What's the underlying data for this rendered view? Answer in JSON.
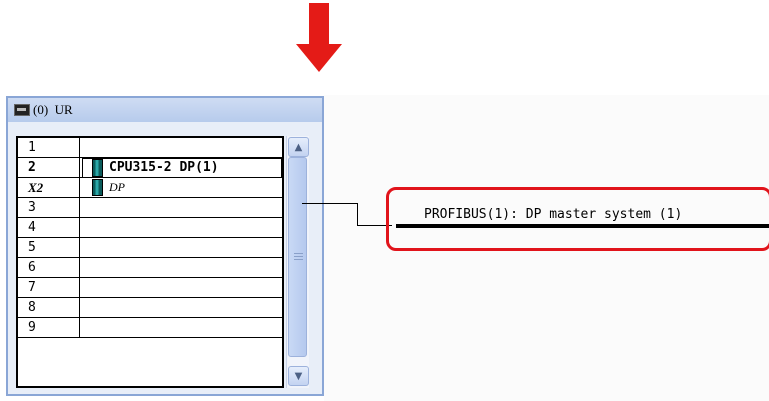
{
  "colors": {
    "arrow": "#e41b17",
    "highlight_box": "#e1141b",
    "titlebar": "#c4d4ef",
    "bus": "#000000",
    "module_icon": "#1a7a7a"
  },
  "rack": {
    "title": "(0)  UR",
    "icon": "rack-icon",
    "slots": [
      {
        "num": "1",
        "module": ""
      },
      {
        "num": "2",
        "module": "CPU315-2 DP(1)"
      },
      {
        "num": "X2",
        "module": "DP"
      },
      {
        "num": "3",
        "module": ""
      },
      {
        "num": "4",
        "module": ""
      },
      {
        "num": "5",
        "module": ""
      },
      {
        "num": "6",
        "module": ""
      },
      {
        "num": "7",
        "module": ""
      },
      {
        "num": "8",
        "module": ""
      },
      {
        "num": "9",
        "module": ""
      }
    ],
    "scroll_up_icon": "chevron-up-icon",
    "scroll_down_icon": "chevron-down-icon"
  },
  "network": {
    "master_system_label": "PROFIBUS(1): DP master system (1)"
  },
  "indicator": {
    "icon": "down-arrow-icon"
  }
}
